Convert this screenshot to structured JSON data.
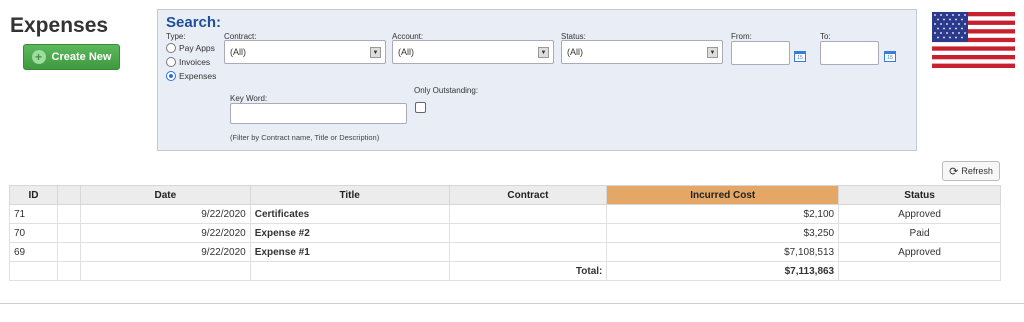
{
  "page": {
    "title": "Expenses",
    "create_label": "Create New"
  },
  "search": {
    "title": "Search:",
    "type_label": "Type:",
    "type_options": [
      "Pay Apps",
      "Invoices",
      "Expenses"
    ],
    "type_selected": "Expenses",
    "contract_label": "Contract:",
    "contract_value": "(All)",
    "account_label": "Account:",
    "account_value": "(All)",
    "status_label": "Status:",
    "status_value": "(All)",
    "from_label": "From:",
    "to_label": "To:",
    "keyword_label": "Key Word:",
    "keyword_hint": "(Filter by Contract name, Title or Description)",
    "outstanding_label": "Only Outstanding:",
    "outstanding_checked": false
  },
  "refresh_label": "Refresh",
  "table": {
    "columns": [
      "ID",
      "",
      "Date",
      "Title",
      "Contract",
      "Incurred Cost",
      "Status"
    ],
    "rows": [
      {
        "id": "71",
        "date": "9/22/2020",
        "title": "Certificates",
        "contract": "",
        "cost": "$2,100",
        "status": "Approved"
      },
      {
        "id": "70",
        "date": "9/22/2020",
        "title": "Expense #2",
        "contract": "",
        "cost": "$3,250",
        "status": "Paid"
      },
      {
        "id": "69",
        "date": "9/22/2020",
        "title": "Expense #1",
        "contract": "",
        "cost": "$7,108,513",
        "status": "Approved"
      }
    ],
    "total_label": "Total:",
    "total_value": "$7,113,863"
  },
  "colors": {
    "accent": "#1f4f9b",
    "create_button": "#4cae4c",
    "sorted_header": "#e5a766",
    "panel_bg": "#e9edf5"
  },
  "icons": {
    "create": "plus-circle-icon",
    "calendar": "calendar-icon",
    "refresh": "refresh-icon",
    "flag": "us-flag-icon"
  }
}
